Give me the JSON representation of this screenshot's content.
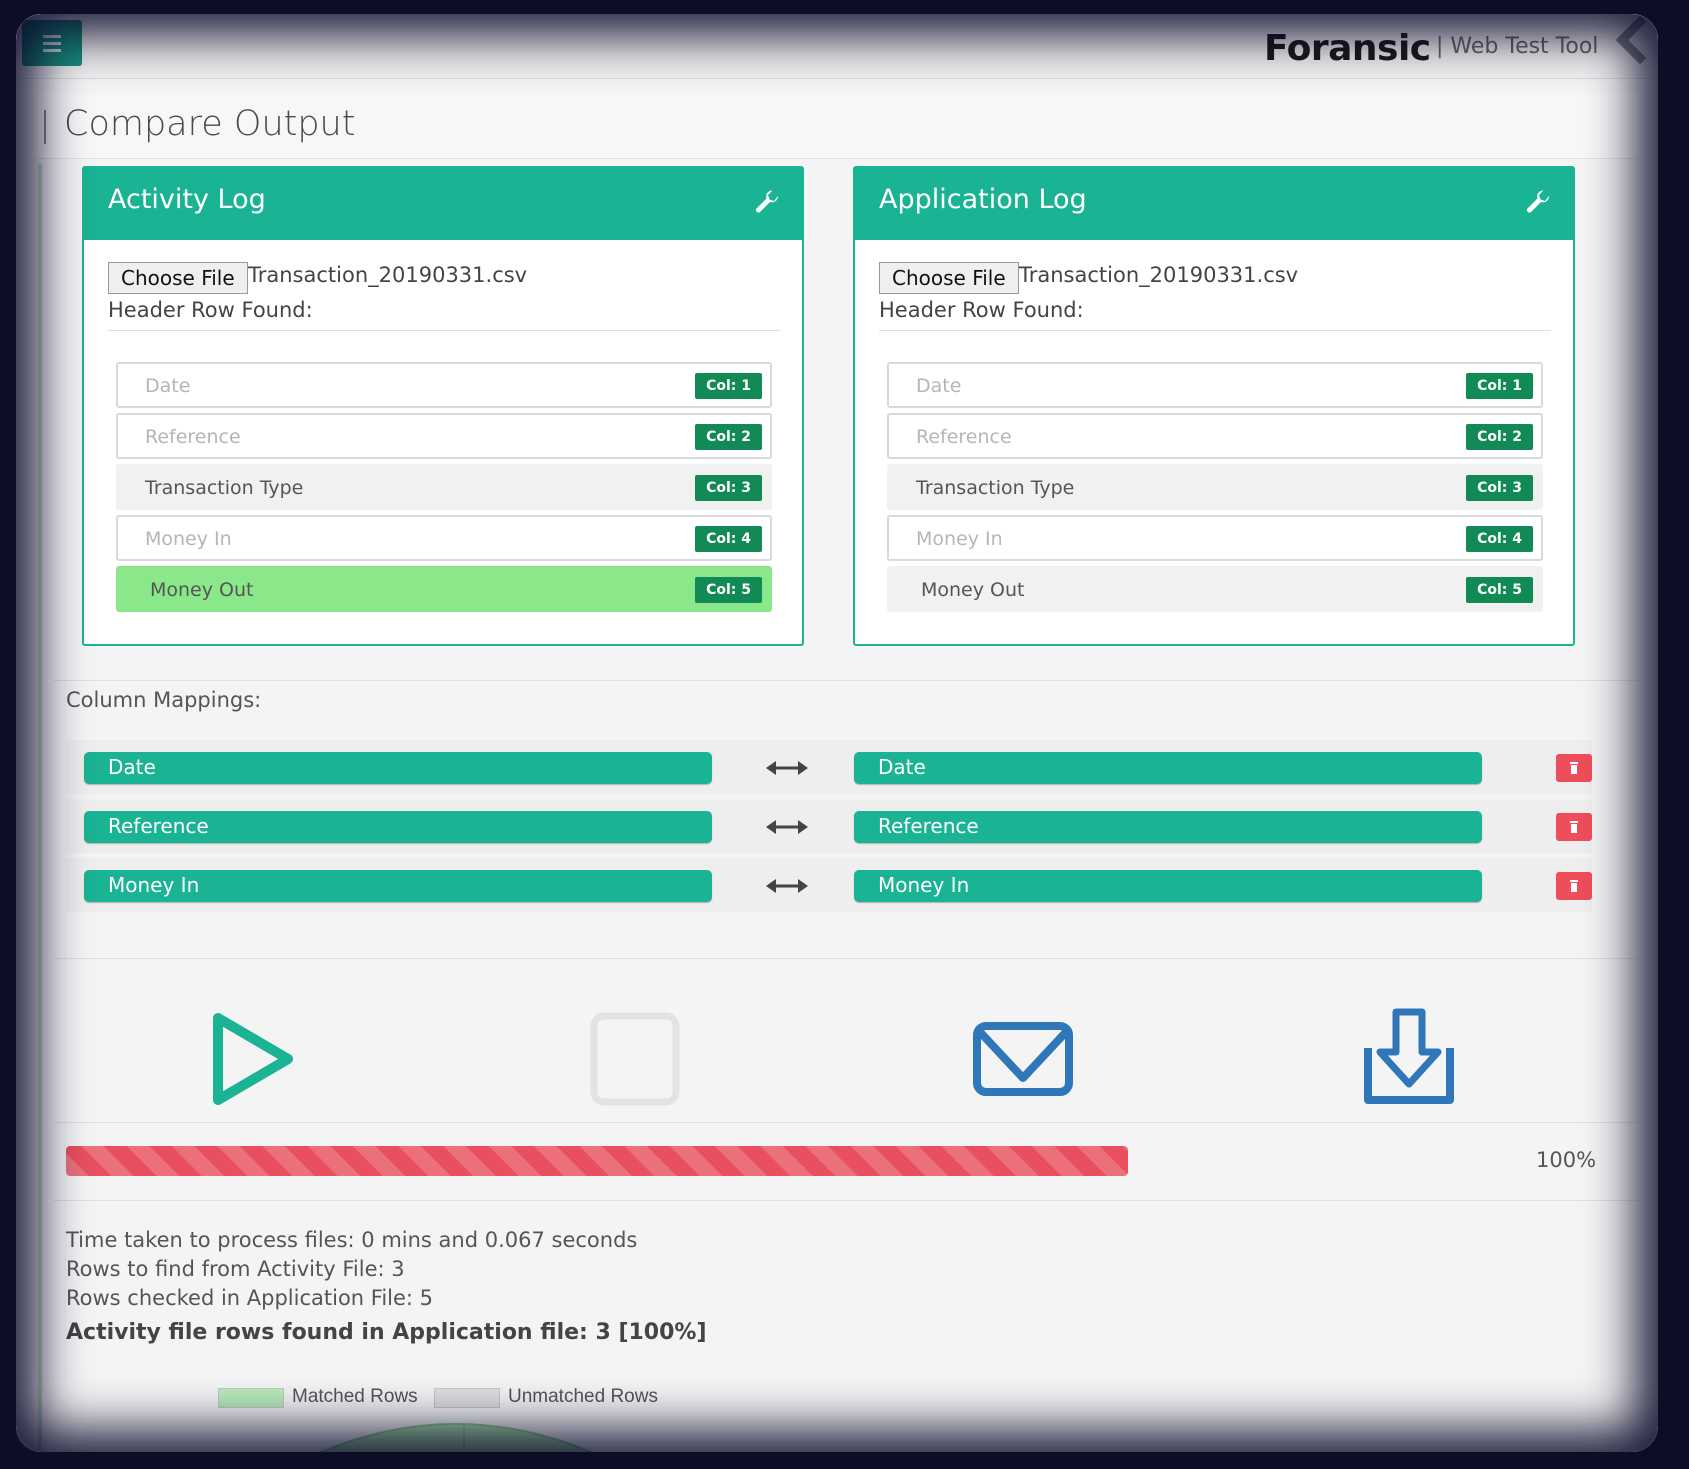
{
  "app": {
    "brand": "Foransic",
    "tool_label": "| Web Test Tool"
  },
  "page": {
    "title": "Compare Output"
  },
  "panels": [
    {
      "title": "Activity Log",
      "choose_file_label": "Choose File",
      "file_name": "Transaction_20190331.csv",
      "header_found_label": "Header Row Found:",
      "columns": [
        {
          "label": "Date",
          "badge": "Col: 1",
          "state": "outline"
        },
        {
          "label": "Reference",
          "badge": "Col: 2",
          "state": "outline"
        },
        {
          "label": "Transaction Type",
          "badge": "Col: 3",
          "state": "plain"
        },
        {
          "label": "Money In",
          "badge": "Col: 4",
          "state": "outline"
        },
        {
          "label": "Money Out",
          "badge": "Col: 5",
          "state": "active"
        }
      ]
    },
    {
      "title": "Application Log",
      "choose_file_label": "Choose File",
      "file_name": "Transaction_20190331.csv",
      "header_found_label": "Header Row Found:",
      "columns": [
        {
          "label": "Date",
          "badge": "Col: 1",
          "state": "outline"
        },
        {
          "label": "Reference",
          "badge": "Col: 2",
          "state": "outline"
        },
        {
          "label": "Transaction Type",
          "badge": "Col: 3",
          "state": "plain"
        },
        {
          "label": "Money In",
          "badge": "Col: 4",
          "state": "outline"
        },
        {
          "label": "Money Out",
          "badge": "Col: 5",
          "state": "plain"
        }
      ]
    }
  ],
  "mappings": {
    "label": "Column Mappings:",
    "rows": [
      {
        "left": "Date",
        "right": "Date"
      },
      {
        "left": "Reference",
        "right": "Reference"
      },
      {
        "left": "Money In",
        "right": "Money In"
      }
    ]
  },
  "actions": [
    {
      "name": "play-icon",
      "color": "#1ab394"
    },
    {
      "name": "stop-icon",
      "color": "#e3e3e3"
    },
    {
      "name": "email-icon",
      "color": "#2f77b8"
    },
    {
      "name": "download-icon",
      "color": "#2f77b8"
    }
  ],
  "progress": {
    "fraction": 0.674,
    "label": "100%",
    "color": "#e8505f"
  },
  "stats": {
    "time": "Time taken to process files: 0 mins and 0.067 seconds",
    "rows_to_find": "Rows to find from Activity File: 3",
    "rows_checked": "Rows checked in Application File: 5",
    "found": "Activity file rows found in Application file: 3 [100%]"
  },
  "legend": [
    {
      "label": "Matched Rows",
      "color": "#b8ecb8"
    },
    {
      "label": "Unmatched Rows",
      "color": "#e0e0e0"
    }
  ],
  "colors": {
    "brand_green": "#1ab394",
    "badge_green": "#128a55",
    "active_row": "#8ae88a",
    "danger": "#ee4d5a"
  }
}
